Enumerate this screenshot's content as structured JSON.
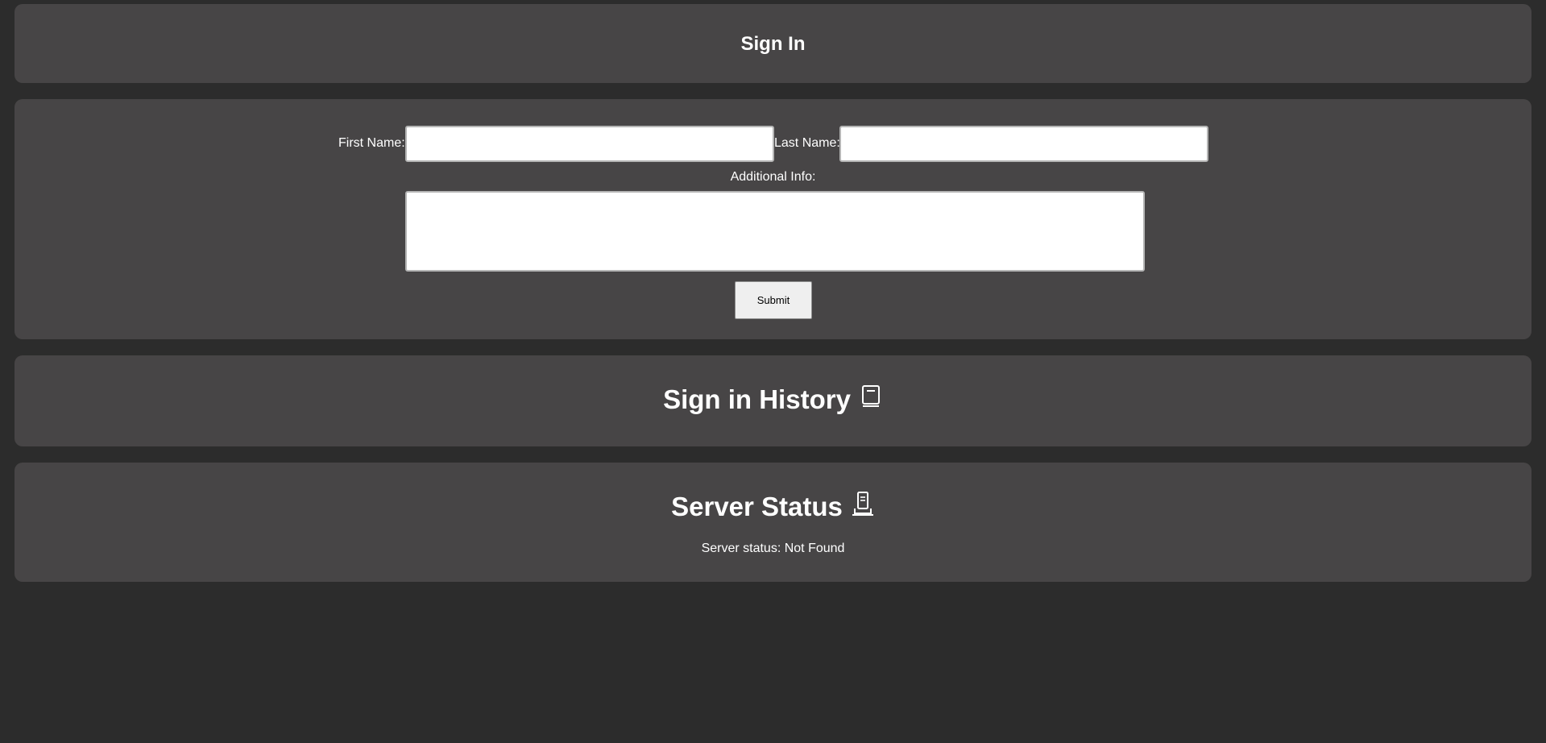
{
  "signin_header": {
    "title": "Sign In"
  },
  "form": {
    "first_name_label": "First Name:",
    "first_name_value": "",
    "last_name_label": "Last Name:",
    "last_name_value": "",
    "additional_info_label": "Additional Info:",
    "additional_info_value": "",
    "submit_label": "Submit"
  },
  "history": {
    "title": "Sign in History",
    "icon": "book-icon"
  },
  "server": {
    "title": "Server Status",
    "icon": "server-icon",
    "status_prefix": "Server status: ",
    "status_value": "Not Found"
  },
  "colors": {
    "background": "#2c2c2c",
    "card": "#474546",
    "text": "#ffffff",
    "button": "#efefef"
  }
}
